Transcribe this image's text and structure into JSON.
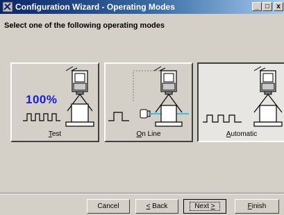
{
  "window": {
    "title": "Configuration Wizard - Operating Modes",
    "controls": {
      "minimize": "_",
      "maximize": "□",
      "close": "x"
    }
  },
  "instruction": "Select one of the following operating modes",
  "modes": [
    {
      "key": "T",
      "rest": "est",
      "percent": "100%",
      "selected": false
    },
    {
      "key": "O",
      "rest": "n Line",
      "selected": false
    },
    {
      "key": "A",
      "rest": "utomatic",
      "selected": true
    }
  ],
  "buttons": {
    "cancel": "Cancel",
    "back_key": "<",
    "back_rest": " Back",
    "next_rest": "Next ",
    "next_key": ">",
    "finish_key": "F",
    "finish_rest": "inish"
  },
  "colors": {
    "title_start": "#0a246a",
    "title_end": "#a6caf0",
    "percent_text": "#1a1adb",
    "beam": "#2ec4e8"
  }
}
